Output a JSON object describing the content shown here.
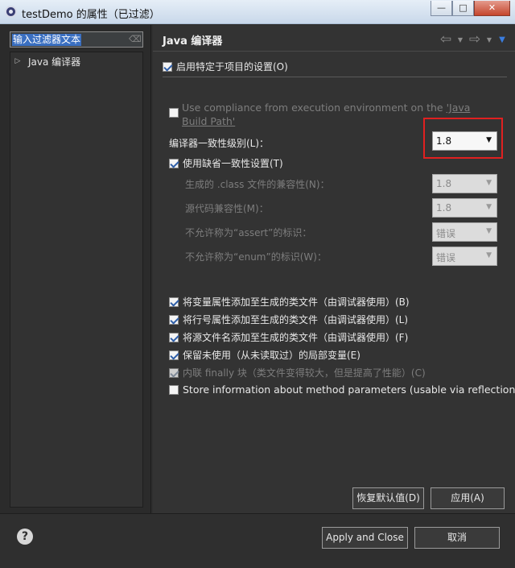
{
  "window": {
    "title": "testDemo 的属性（已过滤）",
    "buttons": {
      "minimize": "—",
      "maximize": "□",
      "close": "✕"
    }
  },
  "sidebar": {
    "filter_text": "输入过滤器文本",
    "tree": [
      {
        "label": "Java 编译器",
        "expanded": false
      }
    ]
  },
  "page": {
    "title": "Java 编译器",
    "icons": [
      "back-arrow-icon",
      "dropdown-icon",
      "forward-arrow-icon",
      "dropdown-icon",
      "view-menu-icon"
    ],
    "enable_project_settings": {
      "label": "启用特定于项目的设置(O)",
      "checked": true
    },
    "use_compliance": {
      "label_prefix": "Use compliance from execution environment on the ",
      "link_text": "'Java Build Path'",
      "checked": false,
      "enabled": false
    },
    "compliance_level": {
      "label": "编译器一致性级别(L)：",
      "value": "1.8"
    },
    "use_default_compliance": {
      "label": "使用缺省一致性设置(T)",
      "checked": true
    },
    "settings": [
      {
        "label": "生成的 .class 文件的兼容性(N)：",
        "value": "1.8"
      },
      {
        "label": "源代码兼容性(M)：",
        "value": "1.8"
      },
      {
        "label": "不允许称为“assert”的标识：",
        "value": "错误"
      },
      {
        "label": "不允许称为“enum”的标识(W)：",
        "value": "错误"
      }
    ],
    "classfile_options": [
      {
        "label": "将变量属性添加至生成的类文件（由调试器使用）(B)",
        "checked": true,
        "enabled": true
      },
      {
        "label": "将行号属性添加至生成的类文件（由调试器使用）(L)",
        "checked": true,
        "enabled": true
      },
      {
        "label": "将源文件名添加至生成的类文件（由调试器使用）(F)",
        "checked": true,
        "enabled": true
      },
      {
        "label": "保留未使用（从未读取过）的局部变量(E)",
        "checked": true,
        "enabled": true
      },
      {
        "label": "内联 finally 块（类文件变得较大，但是提高了性能）(C)",
        "checked": true,
        "enabled": false
      },
      {
        "label": "Store information about method parameters (usable via reflection)",
        "checked": false,
        "enabled": true
      }
    ],
    "restore_defaults": "恢复默认值(D)",
    "apply": "应用(A)"
  },
  "footer": {
    "help": "?",
    "apply_close": "Apply and Close",
    "cancel": "取消"
  },
  "colors": {
    "highlight": "#e02020",
    "accent": "#3a7de0"
  }
}
